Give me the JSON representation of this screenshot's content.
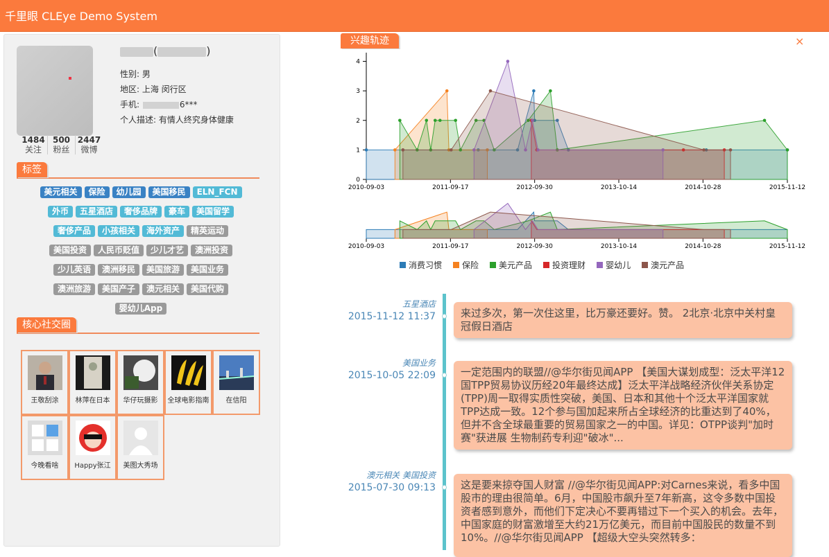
{
  "header": {
    "title": "千里眼 CLEye Demo System"
  },
  "profile": {
    "name_suffix": "(",
    "name_close": ")",
    "gender": "性别: 男",
    "region": "地区: 上海 闵行区",
    "phone_prefix": "手机: ",
    "phone_suffix": "6***",
    "description": "个人描述: 有情人终究身体健康",
    "stats": [
      {
        "num": "1484",
        "label": "关注"
      },
      {
        "num": "500",
        "label": "粉丝"
      },
      {
        "num": "2447",
        "label": "微博"
      }
    ]
  },
  "tags_section": {
    "title": "标签"
  },
  "tags": [
    {
      "text": "美元相关",
      "color": "blue"
    },
    {
      "text": "保险",
      "color": "blue"
    },
    {
      "text": "幼儿园",
      "color": "blue"
    },
    {
      "text": "美国移民",
      "color": "blue"
    },
    {
      "text": "ELN_FCN",
      "color": "cyan"
    },
    {
      "text": "外币",
      "color": "cyan"
    },
    {
      "text": "五星酒店",
      "color": "cyan"
    },
    {
      "text": "奢侈品牌",
      "color": "cyan"
    },
    {
      "text": "豪车",
      "color": "cyan"
    },
    {
      "text": "美国留学",
      "color": "cyan"
    },
    {
      "text": "奢侈产品",
      "color": "cyan"
    },
    {
      "text": "小孩相关",
      "color": "cyan"
    },
    {
      "text": "海外资产",
      "color": "cyan"
    },
    {
      "text": "精英运动",
      "color": "gray"
    },
    {
      "text": "美国投资",
      "color": "gray"
    },
    {
      "text": "人民币贬值",
      "color": "gray"
    },
    {
      "text": "少儿才艺",
      "color": "gray"
    },
    {
      "text": "澳洲投资",
      "color": "gray"
    },
    {
      "text": "少儿英语",
      "color": "gray"
    },
    {
      "text": "澳洲移民",
      "color": "gray"
    },
    {
      "text": "美国旅游",
      "color": "gray"
    },
    {
      "text": "美国业务",
      "color": "gray"
    },
    {
      "text": "澳洲旅游",
      "color": "gray"
    },
    {
      "text": "美国产子",
      "color": "gray"
    },
    {
      "text": "澳元相关",
      "color": "gray"
    },
    {
      "text": "美国代购",
      "color": "gray"
    },
    {
      "text": "婴幼儿App",
      "color": "gray"
    }
  ],
  "social_section": {
    "title": "核心社交圈"
  },
  "social": [
    {
      "name": "王敬刮涂",
      "icon": "person-photo"
    },
    {
      "name": "林萍在日本",
      "icon": "tree-photo"
    },
    {
      "name": "华仔玩摄影",
      "icon": "sky-photo"
    },
    {
      "name": "全球电影指南",
      "icon": "banana-logo"
    },
    {
      "name": "在信阳",
      "icon": "city-photo"
    },
    {
      "name": "今晚看啥",
      "icon": "app-logo"
    },
    {
      "name": "Happy张江",
      "icon": "monkey-logo"
    },
    {
      "name": "美图大秀场",
      "icon": "default-avatar"
    }
  ],
  "interest": {
    "title": "兴趣轨迹",
    "close": "×"
  },
  "colors": {
    "accent": "#fb7a3d",
    "消费习惯": "#2c7bb6",
    "保险": "#f58220",
    "美元产品": "#2ca02c",
    "投资理财": "#d62728",
    "婴幼儿": "#9467bd",
    "澳元产品": "#8c564b"
  },
  "chart_data": {
    "type": "area",
    "x_ticks": [
      "2010-09-03",
      "2011-09-17",
      "2012-09-30",
      "2013-10-14",
      "2014-10-28",
      "2015-11-12"
    ],
    "y_ticks": [
      0,
      1,
      2,
      3,
      4
    ],
    "ylim": [
      0,
      4.2
    ],
    "xlim": [
      "2010-09-03",
      "2015-11-12"
    ],
    "series": [
      {
        "name": "消费习惯",
        "points": [
          [
            "2010-09-03",
            1
          ],
          [
            "2011-02-15",
            1
          ],
          [
            "2012-01-20",
            1
          ],
          [
            "2012-07-15",
            1
          ],
          [
            "2012-09-26",
            3
          ],
          [
            "2012-09-30",
            2
          ],
          [
            "2013-01-10",
            2
          ],
          [
            "2013-03-01",
            1
          ],
          [
            "2014-11-12",
            1
          ],
          [
            "2015-11-12",
            1
          ]
        ]
      },
      {
        "name": "保险",
        "points": [
          [
            "2011-01-10",
            1
          ],
          [
            "2011-09-01",
            3
          ],
          [
            "2011-09-10",
            1
          ],
          [
            "2012-03-01",
            1
          ]
        ]
      },
      {
        "name": "美元产品",
        "points": [
          [
            "2011-02-01",
            2
          ],
          [
            "2011-04-20",
            1
          ],
          [
            "2011-06-01",
            2
          ],
          [
            "2011-06-20",
            1
          ],
          [
            "2011-07-10",
            2
          ],
          [
            "2011-08-01",
            2
          ],
          [
            "2011-10-10",
            2
          ],
          [
            "2011-11-01",
            1
          ],
          [
            "2012-01-10",
            2
          ],
          [
            "2012-02-15",
            2
          ],
          [
            "2012-04-01",
            1
          ],
          [
            "2012-09-01",
            2
          ],
          [
            "2012-12-10",
            3
          ],
          [
            "2013-01-10",
            1
          ],
          [
            "2015-08-01",
            2
          ],
          [
            "2015-11-12",
            1
          ]
        ]
      },
      {
        "name": "投资理财",
        "points": [
          [
            "2012-09-15",
            2
          ],
          [
            "2012-10-10",
            1
          ],
          [
            "2014-08-01",
            1
          ],
          [
            "2015-02-01",
            1
          ]
        ]
      },
      {
        "name": "婴幼儿",
        "points": [
          [
            "2012-01-01",
            1
          ],
          [
            "2012-06-01",
            4
          ],
          [
            "2012-08-20",
            1
          ],
          [
            "2012-09-20",
            2
          ],
          [
            "2012-10-15",
            1
          ],
          [
            "2014-05-01",
            1
          ]
        ]
      },
      {
        "name": "澳元产品",
        "points": [
          [
            "2011-02-15",
            1
          ],
          [
            "2011-09-20",
            1
          ],
          [
            "2012-03-15",
            3
          ],
          [
            "2014-11-01",
            1
          ],
          [
            "2015-03-01",
            1
          ]
        ]
      }
    ],
    "legend": [
      "消费习惯",
      "保险",
      "美元产品",
      "投资理财",
      "婴幼儿",
      "澳元产品"
    ],
    "legend_position": "bottom"
  },
  "posts": [
    {
      "tags": "五星酒店",
      "time": "2015-11-12 11:37",
      "text": "来过多次，第一次住这里，比万豪还要好。赞。 2北京·北京中关村皇冠假日酒店"
    },
    {
      "tags": "美国业务",
      "time": "2015-10-05 22:09",
      "text": "一定范围内的联盟//@华尔街见闻APP 【美国大谋划成型：泛太平洋12国TPP贸易协议历经20年最终达成】泛太平洋战略经济伙伴关系协定(TPP)周一取得实质性突破，美国、日本和其他十个泛太平洋国家就TPP达成一致。12个参与国加起来所占全球经济的比重达到了40%，但并不含全球最重要的贸易国家之一的中国。详见：OTPP谈判\"加时赛\"获进展 生物制药专利迎\"破冰\"..."
    },
    {
      "tags": "澳元相关  美国投资",
      "time": "2015-07-30 09:13",
      "text": "这是要来掠夺国人财富 //@华尔街见闻APP:对Carnes来说，看多中国股市的理由很简单。6月，中国股市飙升至7年新高，这令多数中国投资者感到意外，而他们下定决心不要再错过下一个买入的机会。去年，中国家庭的财富激增至大约21万亿美元，而目前中国股民的数量不到10%。//@华尔街见闻APP 【超级大空头突然转多："
    }
  ]
}
